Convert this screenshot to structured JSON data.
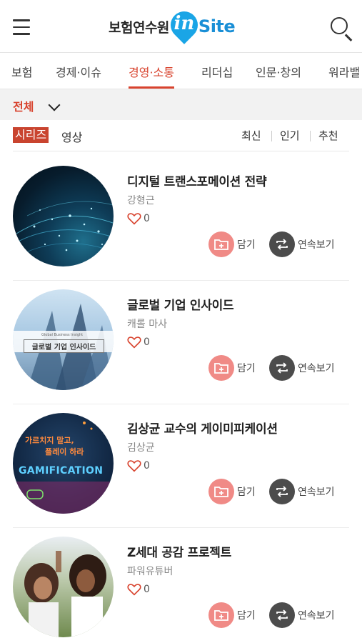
{
  "header": {
    "logo_text": "보험연수원",
    "logo_in": "in",
    "logo_site": "Site"
  },
  "nav": {
    "items": [
      {
        "label": "보험",
        "active": false
      },
      {
        "label": "경제·이슈",
        "active": false
      },
      {
        "label": "경영·소통",
        "active": true
      },
      {
        "label": "리더십",
        "active": false
      },
      {
        "label": "인문·창의",
        "active": false
      },
      {
        "label": "워라밸",
        "active": false
      }
    ]
  },
  "filter": {
    "selected": "전체"
  },
  "sub_tabs": {
    "series": "시리즈",
    "video": "영상",
    "sort": [
      "최신",
      "인기",
      "추천"
    ]
  },
  "cards": [
    {
      "title": "디지털 트랜스포메이션 전략",
      "author": "강형근",
      "likes": "0",
      "save_label": "담기",
      "continue_label": "연속보기"
    },
    {
      "title": "글로벌 기업 인사이드",
      "author": "캐롤 마사",
      "likes": "0",
      "save_label": "담기",
      "continue_label": "연속보기",
      "thumb_caption_small": "Global Business Insight",
      "thumb_caption": "글로벌 기업 인사이드"
    },
    {
      "title": "김상균 교수의 게이미피케이션",
      "author": "김상균",
      "likes": "0",
      "save_label": "담기",
      "continue_label": "연속보기",
      "thumb_line1": "가르치지 말고,",
      "thumb_line2": "플레이 하라",
      "thumb_word": "GAMIFICATION"
    },
    {
      "title": "Z세대 공감 프로젝트",
      "author": "파워유튜버",
      "likes": "0",
      "save_label": "담기",
      "continue_label": "연속보기"
    }
  ],
  "colors": {
    "accent": "#d8432e",
    "save_button": "#f08a86",
    "continue_button": "#4c4c4c"
  }
}
